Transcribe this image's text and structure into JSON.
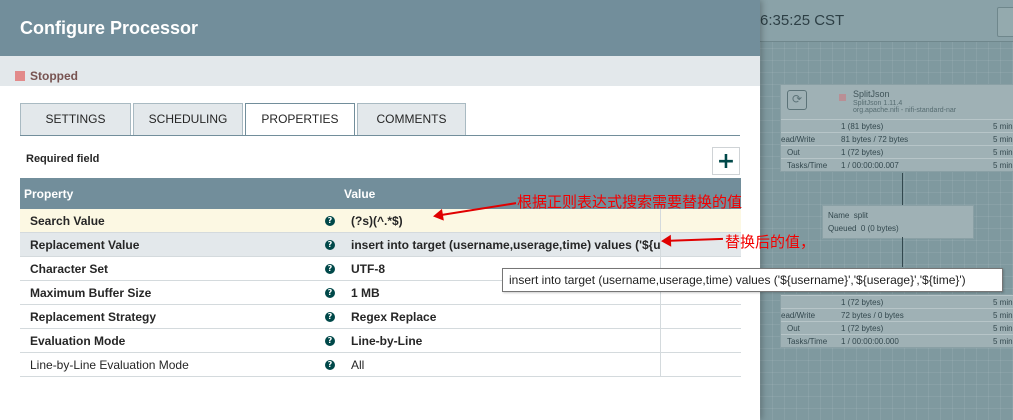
{
  "canvas": {
    "clock": "6:35:25 CST",
    "processor1": {
      "name": "SplitJson",
      "version": "SplitJson 1.11.4",
      "bundle": "org.apache.nifi - nifi-standard-nar",
      "rows": [
        {
          "k": "",
          "v": "1 (81 bytes)",
          "m": "5 min"
        },
        {
          "k": "ead/Write",
          "v": "81 bytes / 72 bytes",
          "m": "5 min"
        },
        {
          "k": "Out",
          "v": "1 (72 bytes)",
          "m": "5 min"
        },
        {
          "k": "Tasks/Time",
          "v": "1 / 00:00:00.007",
          "m": "5 min"
        }
      ]
    },
    "connection": {
      "name_label": "Name",
      "name": "split",
      "queued_label": "Queued",
      "queued": "0 (0 bytes)"
    },
    "processor2": {
      "rows": [
        {
          "k": "",
          "v": "1 (72 bytes)",
          "m": "5 min"
        },
        {
          "k": "ead/Write",
          "v": "72 bytes / 0 bytes",
          "m": "5 min"
        },
        {
          "k": "Out",
          "v": "1 (72 bytes)",
          "m": "5 min"
        },
        {
          "k": "Tasks/Time",
          "v": "1 / 00:00:00.000",
          "m": "5 min"
        }
      ]
    }
  },
  "dialog": {
    "title": "Configure Processor",
    "status": "Stopped",
    "tabs": [
      {
        "label": "SETTINGS",
        "active": false
      },
      {
        "label": "SCHEDULING",
        "active": false
      },
      {
        "label": "PROPERTIES",
        "active": true
      },
      {
        "label": "COMMENTS",
        "active": false
      }
    ],
    "required_label": "Required field",
    "add_button": "+",
    "table": {
      "header_property": "Property",
      "header_value": "Value",
      "rows": [
        {
          "name": "Search Value",
          "value": "(?s)(^.*$)"
        },
        {
          "name": "Replacement Value",
          "value": "insert into target (username,userage,time) values ('${us..."
        },
        {
          "name": "Character Set",
          "value": "UTF-8"
        },
        {
          "name": "Maximum Buffer Size",
          "value": "1 MB"
        },
        {
          "name": "Replacement Strategy",
          "value": "Regex Replace"
        },
        {
          "name": "Evaluation Mode",
          "value": "Line-by-Line"
        },
        {
          "name": "Line-by-Line Evaluation Mode",
          "value": "All"
        }
      ],
      "help_glyph": "?"
    },
    "tooltip": "insert into target (username,userage,time) values ('${username}','${userage}','${time}')"
  },
  "annotations": {
    "search_note": "根据正则表达式搜索需要替换的值",
    "replace_note": "替换后的值，"
  },
  "colors": {
    "header": "#728e9b",
    "accent": "#004849",
    "annotation": "#f30000",
    "stopped": "#e28a8a"
  }
}
